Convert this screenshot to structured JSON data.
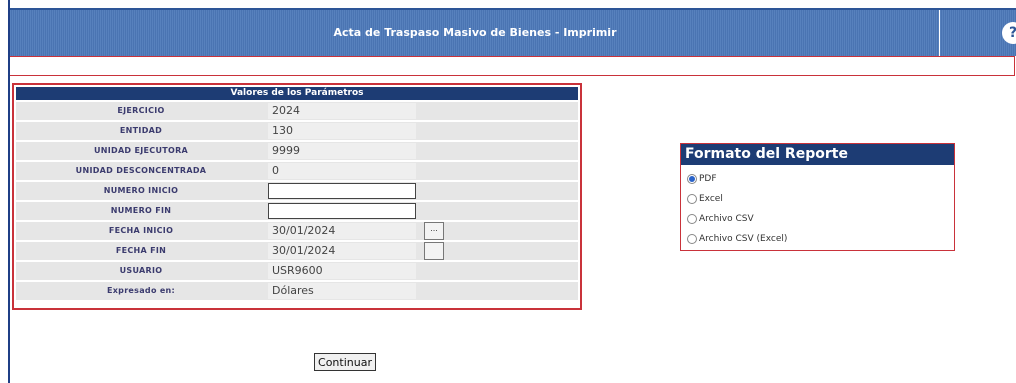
{
  "header": {
    "title": "Acta de Traspaso Masivo de Bienes - Imprimir",
    "icon": "help-icon"
  },
  "params": {
    "title": "Valores de los Parámetros",
    "rows": [
      {
        "label": "EJERCICIO",
        "value": "2024"
      },
      {
        "label": "ENTIDAD",
        "value": "130"
      },
      {
        "label": "UNIDAD EJECUTORA",
        "value": "9999"
      },
      {
        "label": "UNIDAD DESCONCENTRADA",
        "value": "0"
      },
      {
        "label": "NUMERO INICIO",
        "value": ""
      },
      {
        "label": "NUMERO FIN",
        "value": ""
      },
      {
        "label": "FECHA INICIO",
        "value": "30/01/2024",
        "button": "..."
      },
      {
        "label": "FECHA FIN",
        "value": "30/01/2024",
        "button": ""
      },
      {
        "label": "USUARIO",
        "value": "USR9600"
      },
      {
        "label": "Expresado en:",
        "value": "Dólares"
      }
    ]
  },
  "formato": {
    "title": "Formato del Reporte",
    "selected": "PDF",
    "options": [
      "PDF",
      "Excel",
      "Archivo CSV",
      "Archivo CSV (Excel)"
    ]
  },
  "continuar_label": "Continuar"
}
